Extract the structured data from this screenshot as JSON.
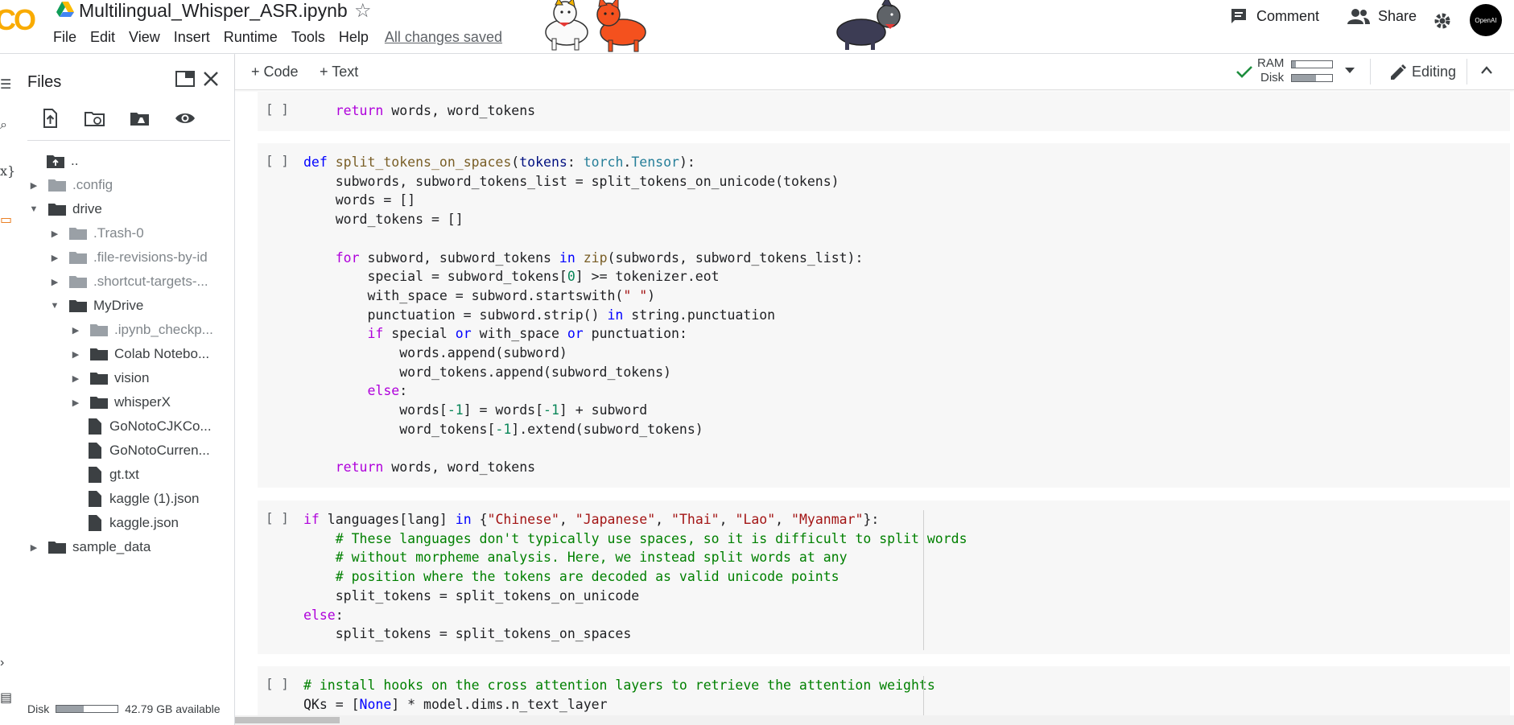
{
  "header": {
    "logo_text": "CO",
    "notebook_title": "Multilingual_Whisper_ASR.ipynb",
    "menu": [
      "File",
      "Edit",
      "View",
      "Insert",
      "Runtime",
      "Tools",
      "Help"
    ],
    "save_status": "All changes saved",
    "comment_label": "Comment",
    "share_label": "Share",
    "avatar_text": "OpenAI"
  },
  "toolbar": {
    "code_label": "+ Code",
    "text_label": "+ Text",
    "ram_label": "RAM",
    "disk_label": "Disk",
    "ram_fraction": 0.1,
    "disk_fraction": 0.6,
    "editing_label": "Editing"
  },
  "files": {
    "title": "Files",
    "tree": [
      {
        "name": "..",
        "kind": "up"
      },
      {
        "name": ".config",
        "kind": "folder",
        "collapsed": true,
        "dim": true
      },
      {
        "name": "drive",
        "kind": "folder",
        "expanded": true
      },
      {
        "name": ".Trash-0",
        "kind": "folder",
        "collapsed": true,
        "dim": true
      },
      {
        "name": ".file-revisions-by-id",
        "kind": "folder",
        "collapsed": true,
        "dim": true
      },
      {
        "name": ".shortcut-targets-...",
        "kind": "folder",
        "collapsed": true,
        "dim": true
      },
      {
        "name": "MyDrive",
        "kind": "folder",
        "expanded": true
      },
      {
        "name": ".ipynb_checkp...",
        "kind": "folder",
        "collapsed": true,
        "dim": true
      },
      {
        "name": "Colab Notebo...",
        "kind": "folder",
        "collapsed": true
      },
      {
        "name": "vision",
        "kind": "folder",
        "collapsed": true
      },
      {
        "name": "whisperX",
        "kind": "folder",
        "collapsed": true
      },
      {
        "name": "GoNotoCJKCo...",
        "kind": "file"
      },
      {
        "name": "GoNotoCurren...",
        "kind": "file"
      },
      {
        "name": "gt.txt",
        "kind": "file"
      },
      {
        "name": "kaggle (1).json",
        "kind": "file"
      },
      {
        "name": "kaggle.json",
        "kind": "file"
      },
      {
        "name": "sample_data",
        "kind": "folder",
        "collapsed": true
      }
    ],
    "disk_label": "Disk",
    "disk_fraction": 0.45,
    "disk_available": "42.79 GB available"
  },
  "cells": {
    "run_marker": "[ ]",
    "cell1_line1": "    return words, word_tokens",
    "cell3_line1": "if languages[lang] in {\"Chinese\", \"Japanese\", \"Thai\", \"Lao\", \"Myanmar\"}:",
    "cell4_line1": "# install hooks on the cross attention layers to retrieve the attention weights",
    "cell4_line2": "QKs = [None] * model.dims.n_text_layer"
  },
  "colors": {
    "keyword": "#0000ff",
    "control": "#af00db",
    "function": "#795e26",
    "string": "#a31515",
    "comment": "#008000",
    "number": "#098658",
    "logo": "#f9ab00",
    "check": "#1e8e3e"
  },
  "icons": [
    "google-drive-icon",
    "star-icon",
    "comment-icon",
    "share-icon",
    "settings-icon",
    "check-icon",
    "pencil-icon",
    "chevron-up-icon",
    "upload-icon",
    "refresh-folder-icon",
    "drive-folder-icon",
    "eye-icon",
    "close-icon",
    "new-window-icon",
    "folder-icon",
    "file-icon"
  ]
}
